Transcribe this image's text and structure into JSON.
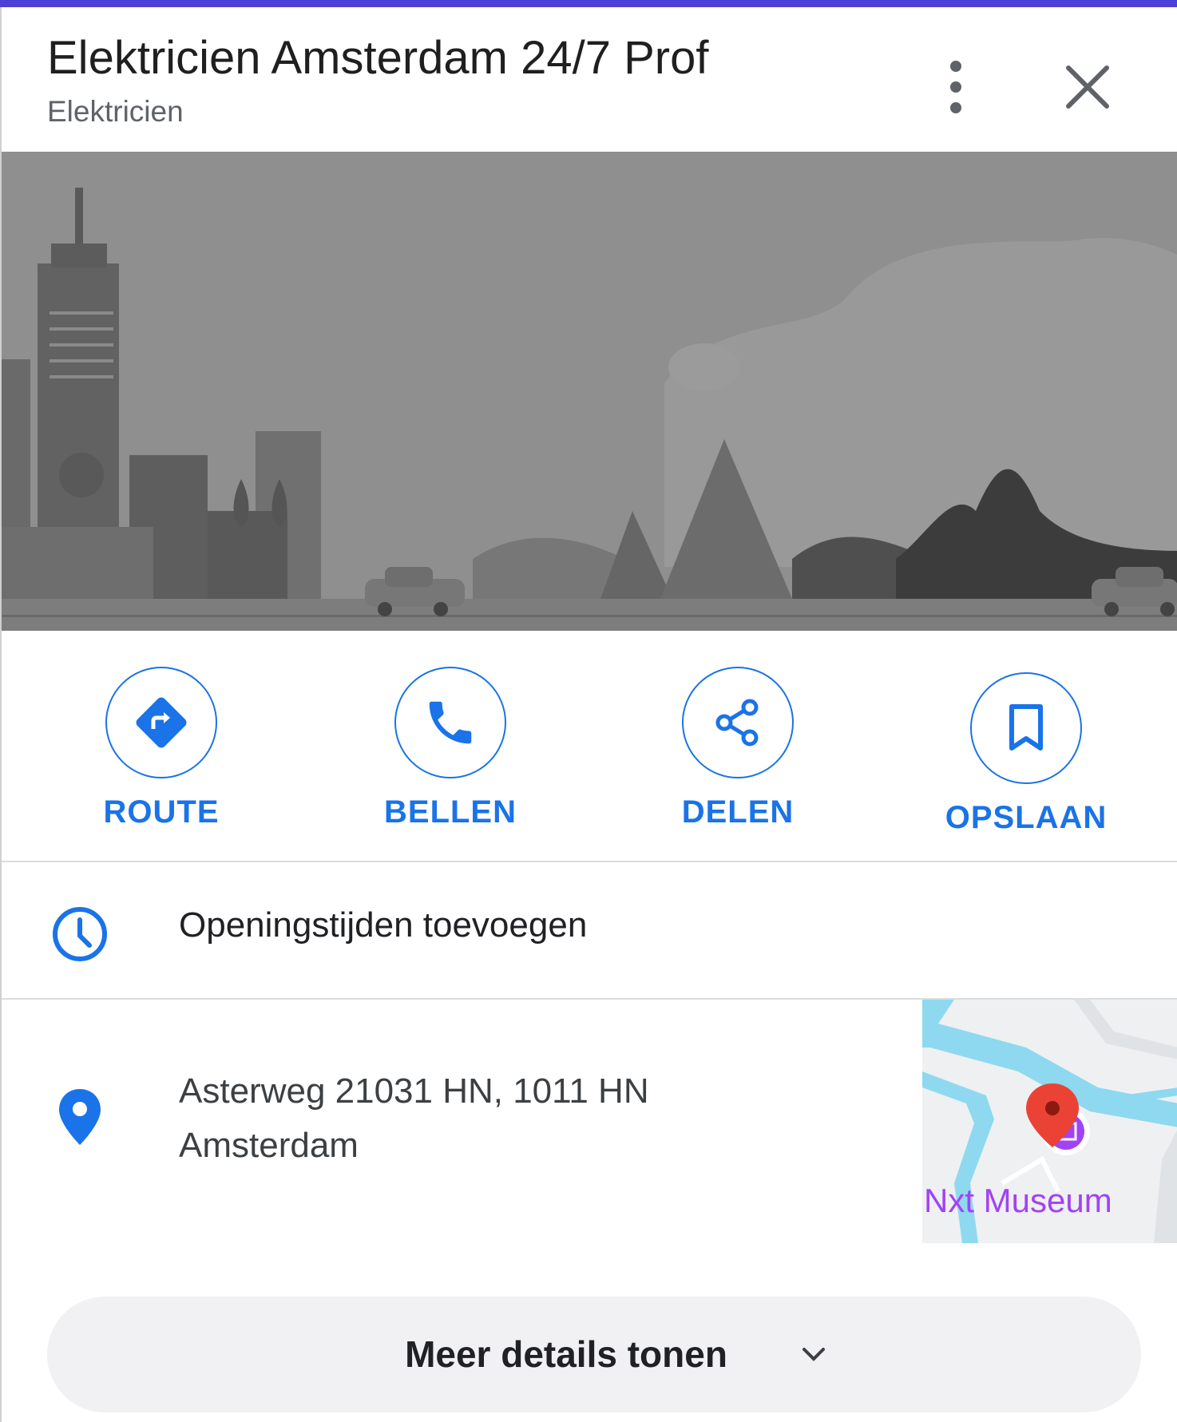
{
  "header": {
    "title": "Elektricien Amsterdam 24/7 Prof",
    "subtitle": "Elektricien",
    "more_icon": "more-vert-icon",
    "close_icon": "close-icon"
  },
  "actions": [
    {
      "label": "ROUTE",
      "icon": "directions-icon"
    },
    {
      "label": "BELLEN",
      "icon": "phone-icon"
    },
    {
      "label": "DELEN",
      "icon": "share-icon"
    },
    {
      "label": "OPSLAAN",
      "icon": "bookmark-icon"
    }
  ],
  "hours": {
    "text": "Openingstijden toevoegen",
    "icon": "clock-icon"
  },
  "address": {
    "line1": "Asterweg 21031 HN, 1011 HN",
    "line2": "Amsterdam",
    "icon": "location-pin-icon"
  },
  "minimap": {
    "poi_label": "Nxt Museum",
    "water_color": "#8ed9f0",
    "pin_color": "#ea4335",
    "poi_color": "#a142f4"
  },
  "details_button": {
    "label": "Meer details tonen",
    "icon": "chevron-down-icon"
  },
  "colors": {
    "accent": "#1a73e8",
    "top_bar": "#4b3fd6"
  }
}
